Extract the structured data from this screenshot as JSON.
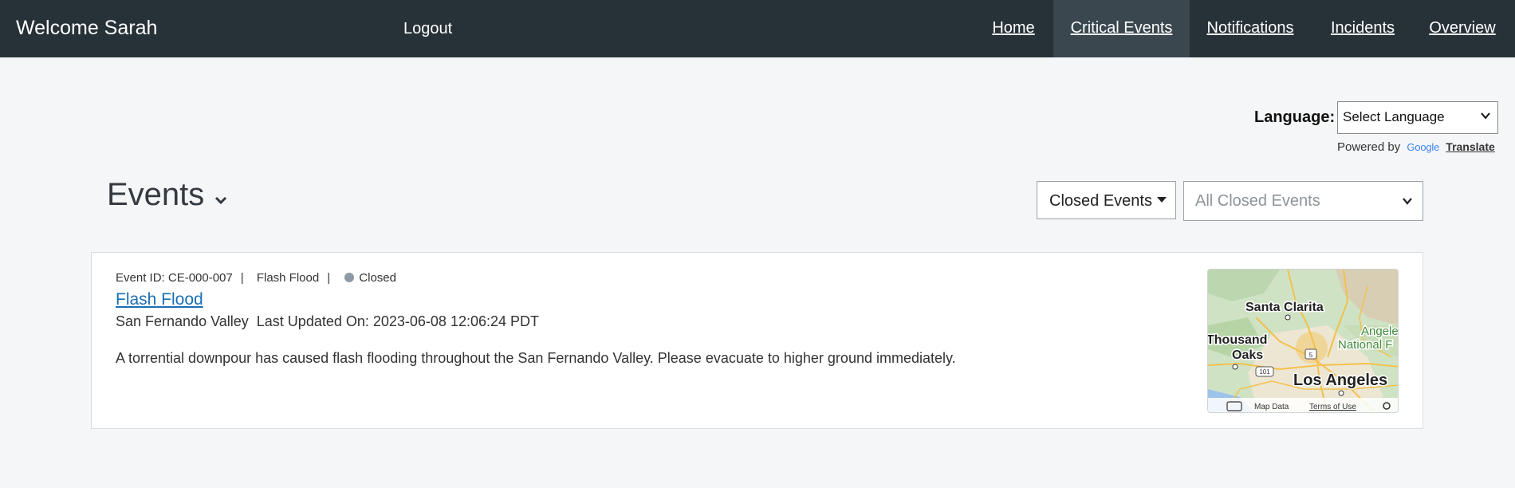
{
  "header": {
    "welcome": "Welcome Sarah",
    "logout": "Logout",
    "nav": [
      {
        "label": "Home"
      },
      {
        "label": "Critical Events"
      },
      {
        "label": "Notifications"
      },
      {
        "label": "Incidents"
      },
      {
        "label": "Overview"
      }
    ],
    "active_nav": "Critical Events"
  },
  "language": {
    "label": "Language:",
    "selected": "Select Language",
    "powered_by": "Powered by",
    "google": "Google",
    "translate": "Translate"
  },
  "events": {
    "title": "Events",
    "filter_button": "Closed Events",
    "filter_select_placeholder": "All Closed Events"
  },
  "event": {
    "id_text": "Event ID: CE-000-007",
    "type": "Flash Flood",
    "status": "Closed",
    "status_color": "#8e9aa5",
    "title": "Flash Flood",
    "location": "San Fernando Valley",
    "last_updated": "Last Updated On: 2023-06-08 12:06:24 PDT",
    "description": "A torrential downpour has caused flash flooding throughout the San Fernando Valley. Please evacuate to higher ground immediately."
  },
  "map": {
    "labels": {
      "santa_clarita": "Santa Clarita",
      "thousand": "Thousand",
      "oaks": "Oaks",
      "angeles": "Angele",
      "national": "National F",
      "los_angeles": "Los Angeles",
      "route_101": "101",
      "route_5": "5"
    },
    "footer": {
      "map_data": "Map Data",
      "terms": "Terms of Use"
    }
  },
  "colors": {
    "navbar": "#273238",
    "nav_active": "#3a474f",
    "link": "#1a6fb3",
    "page_bg": "#f5f6f8"
  }
}
